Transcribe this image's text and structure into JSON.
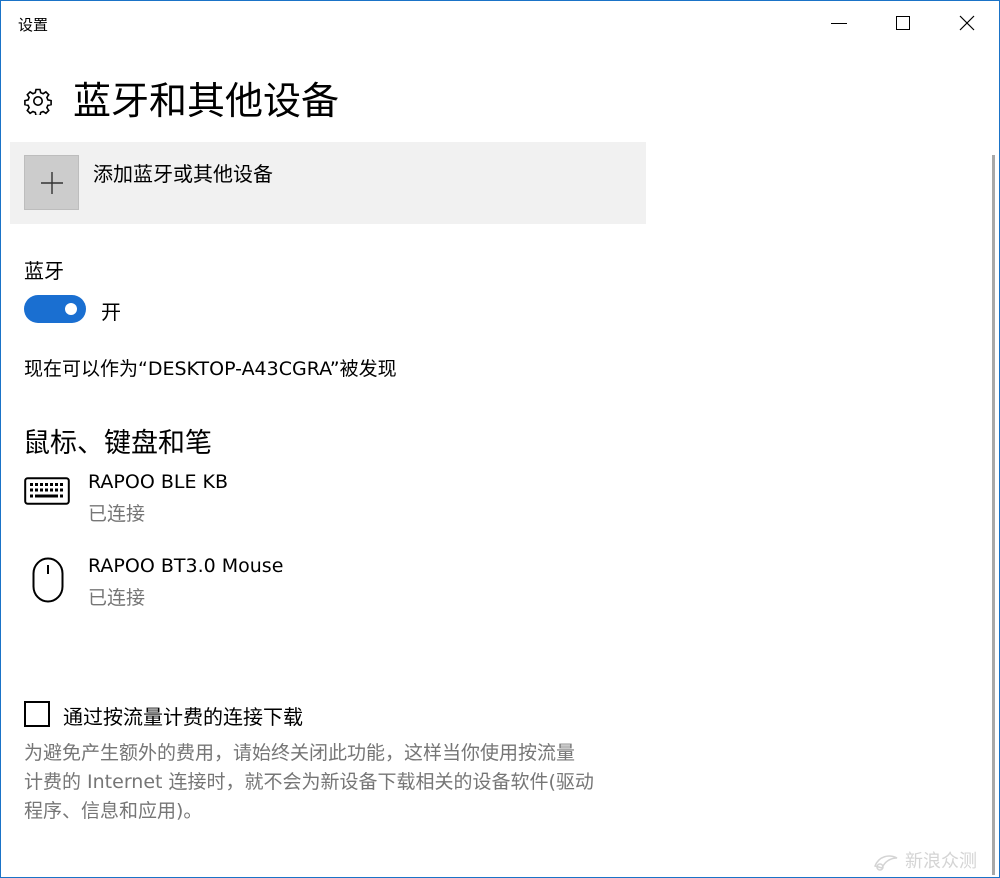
{
  "window": {
    "title": "设置"
  },
  "header": {
    "title": "蓝牙和其他设备",
    "icon": "gear-icon"
  },
  "add_device": {
    "label": "添加蓝牙或其他设备",
    "icon": "plus-icon"
  },
  "bluetooth": {
    "label": "蓝牙",
    "toggle_on": true,
    "toggle_state": "开",
    "toggle_color": "#1a6fd1",
    "discoverable_text": "现在可以作为“DESKTOP-A43CGRA”被发现"
  },
  "section": {
    "heading": "鼠标、键盘和笔"
  },
  "devices": [
    {
      "name": "RAPOO BLE KB",
      "status": "已连接",
      "icon": "keyboard-icon"
    },
    {
      "name": "RAPOO BT3.0 Mouse",
      "status": "已连接",
      "icon": "mouse-icon"
    }
  ],
  "metered": {
    "checked": false,
    "label": "通过按流量计费的连接下载",
    "help_lines": [
      "为避免产生额外的费用，请始终关闭此功能，这样当你使用按流量",
      "计费的 Internet 连接时，就不会为新设备下载相关的设备软件(驱动",
      "程序、信息和应用)。"
    ]
  },
  "watermark": {
    "text": "新浪众测"
  }
}
